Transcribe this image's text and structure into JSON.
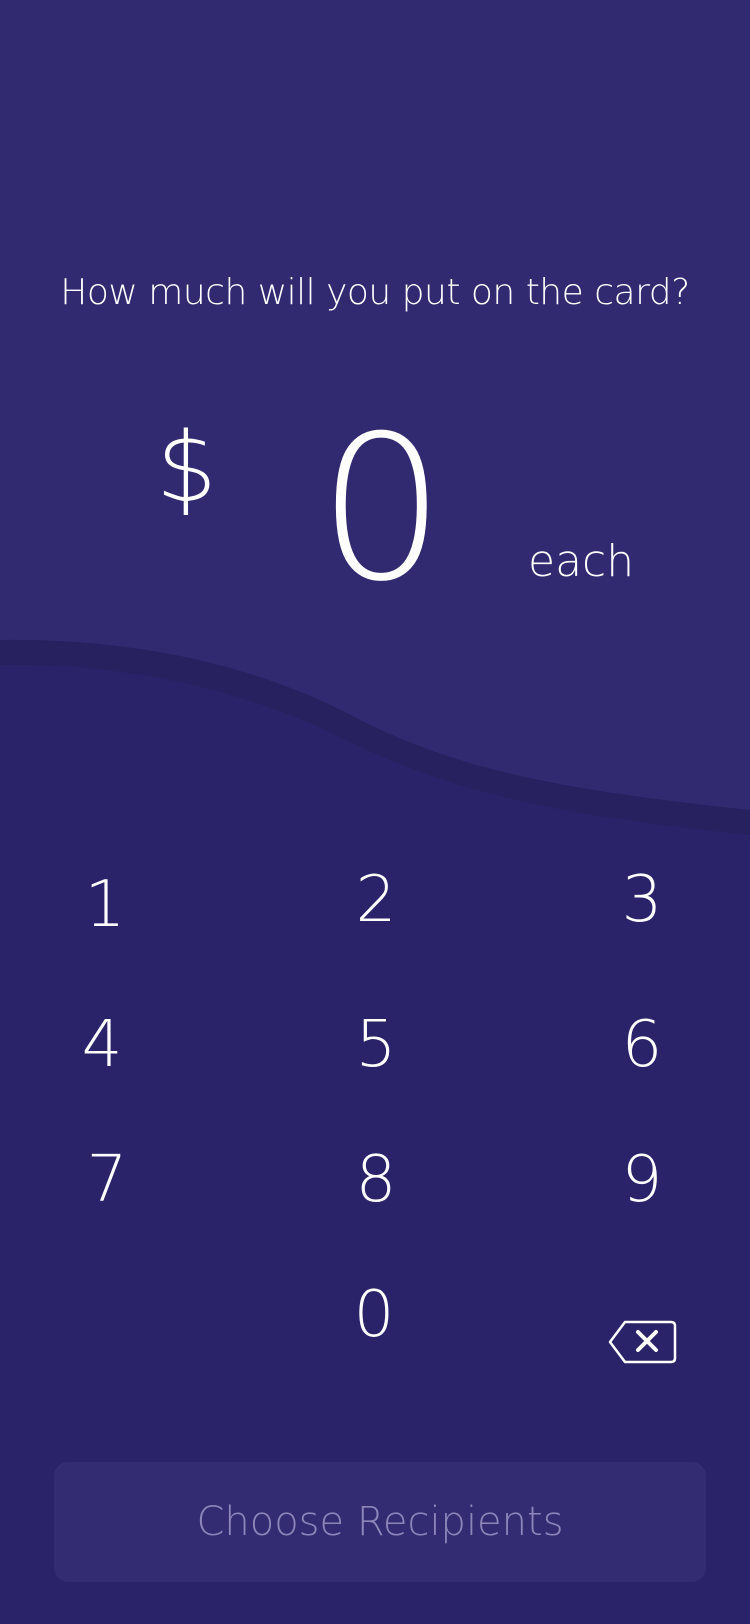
{
  "colors": {
    "top_background": "#312a70",
    "bottom_background": "#2a2369",
    "wave_edge": "#27215f",
    "button_background": "#332c73",
    "button_text": "#8c87b8",
    "text": "#ffffff"
  },
  "header": {
    "prompt": "How much will you put on the card?"
  },
  "amount": {
    "currency_symbol": "$",
    "value": "0",
    "unit": "each"
  },
  "keypad": {
    "keys": [
      "1",
      "2",
      "3",
      "4",
      "5",
      "6",
      "7",
      "8",
      "9",
      "0"
    ],
    "backspace_icon": "backspace-icon"
  },
  "footer": {
    "button_label": "Choose Recipients",
    "button_enabled": false
  }
}
